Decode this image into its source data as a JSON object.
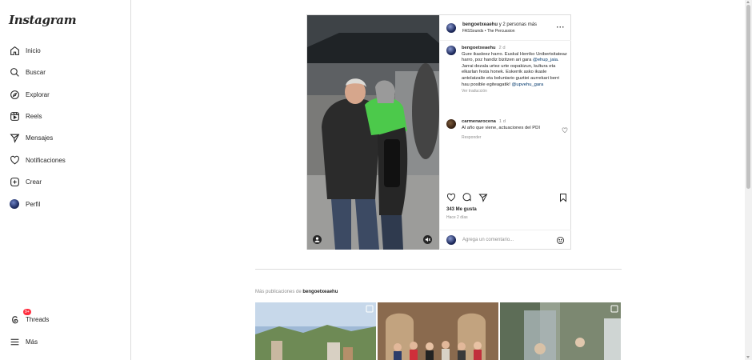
{
  "sidebar": {
    "logo": "Instagram",
    "items": [
      {
        "label": "Inicio",
        "icon": "home-icon"
      },
      {
        "label": "Buscar",
        "icon": "search-icon"
      },
      {
        "label": "Explorar",
        "icon": "compass-icon"
      },
      {
        "label": "Reels",
        "icon": "reels-icon"
      },
      {
        "label": "Mensajes",
        "icon": "send-icon"
      },
      {
        "label": "Notificaciones",
        "icon": "heart-icon"
      },
      {
        "label": "Crear",
        "icon": "plus-square-icon"
      },
      {
        "label": "Perfil",
        "icon": "profile-avatar"
      }
    ],
    "threads": {
      "label": "Threads",
      "badge": "9+"
    },
    "more": {
      "label": "Más"
    }
  },
  "post": {
    "header": {
      "username": "bengoetxeaehu",
      "coauthors": "y 2 personas más",
      "audio": "FASSounds • The Percussion"
    },
    "caption": {
      "username": "bengoetxeaehu",
      "time": "2 d",
      "text_1": "Gure ikasleez harro. Euskal Herriko Unibertsitateaz harro, poz handiz bizitzen ari gara",
      "mention_1": "@ehup_jaia",
      "text_2": ". Jarrai dezala urtez urte ospakizun, kultura eta elkarlan festa honek. Eskerrik asko ikasle antolatzaile eta boluntario guztiei aurrekari berri hau posible egiteagatik!",
      "mention_2": "@upvehu_gara",
      "translate": "Ver traducción"
    },
    "comment": {
      "username": "carmenarocena",
      "time": "1 d",
      "text": "Al año que viene, actuaciones del PDI",
      "reply": "Responder"
    },
    "likes": "343 Me gusta",
    "time_ago": "Hace 2 días",
    "add_comment_placeholder": "Agrega un comentario..."
  },
  "more_posts": {
    "prefix": "Más publicaciones de",
    "username": "bengoetxeaehu"
  },
  "colors": {
    "link": "#00376b",
    "badge": "#ff3040",
    "border": "#dbdbdb",
    "muted": "#8e8e8e"
  }
}
